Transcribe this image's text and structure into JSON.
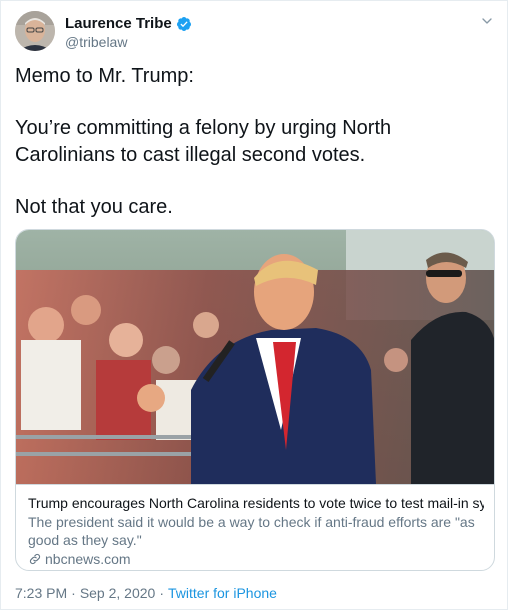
{
  "author": {
    "name": "Laurence Tribe",
    "handle": "@tribelaw",
    "verified": true,
    "verified_color": "#1da1f2",
    "avatar_icon": "profile-photo"
  },
  "tweet": {
    "lines": [
      "Memo to Mr. Trump:",
      "You’re committing a felony by urging North Carolinians to cast illegal second votes.",
      "Not that you care."
    ]
  },
  "link_card": {
    "image_icon": "news-photo",
    "title": "Trump encourages North Carolina residents to vote twice to test mail-in sys...",
    "description": "The president said it would be a way to check if anti-fraud efforts are \"as good as they say.\"",
    "domain": "nbcnews.com",
    "domain_icon": "link-icon"
  },
  "footer": {
    "time": "7:23 PM",
    "separator": "·",
    "date": "Sep 2, 2020",
    "source": "Twitter for iPhone",
    "source_color": "#1b95e0"
  },
  "menu": {
    "icon": "chevron-down-icon"
  }
}
